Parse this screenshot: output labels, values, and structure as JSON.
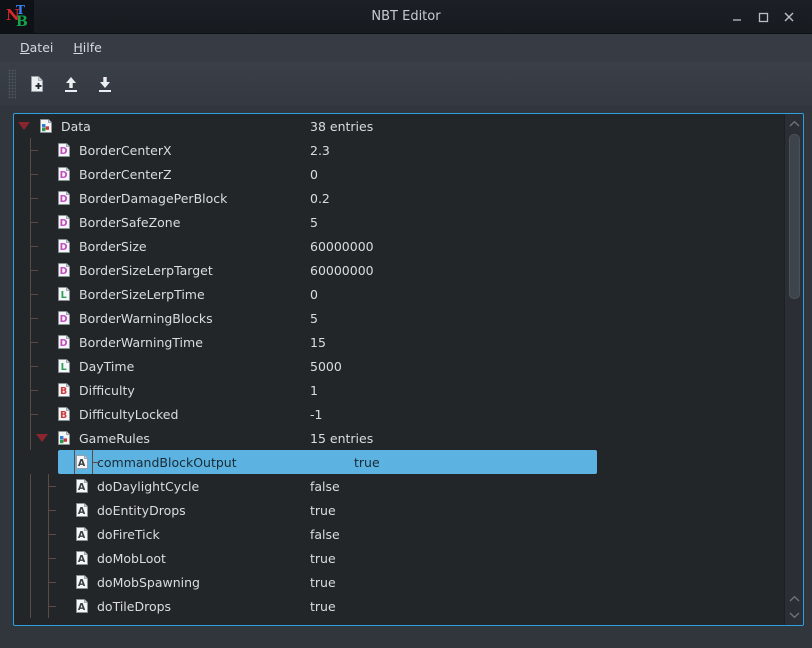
{
  "window": {
    "title": "NBT Editor",
    "logo": {
      "letters": [
        "N",
        "T",
        "B"
      ],
      "colors": [
        "#d62828",
        "#3b82f6",
        "#16a34a"
      ]
    },
    "buttons": [
      {
        "name": "minimize-button",
        "icon": "minimize-icon"
      },
      {
        "name": "maximize-button",
        "icon": "maximize-icon"
      },
      {
        "name": "close-button",
        "icon": "close-icon"
      }
    ]
  },
  "menubar": {
    "items": [
      {
        "label": "Datei",
        "mnemonic": "D",
        "rest": "atei"
      },
      {
        "label": "Hilfe",
        "mnemonic": "H",
        "rest": "ilfe"
      }
    ]
  },
  "toolbar": {
    "buttons": [
      {
        "name": "new-file-button",
        "icon": "new-file-icon"
      },
      {
        "name": "open-file-button",
        "icon": "arrow-up-icon"
      },
      {
        "name": "save-file-button",
        "icon": "arrow-down-icon"
      }
    ]
  },
  "colors": {
    "accent": "#2e9fe0",
    "selection": "#5cb3e2",
    "tree_background": "#232629",
    "chrome": "#31363d",
    "byte_tag": "#d03b3b",
    "double_tag": "#c24ec2",
    "long_tag": "#2f9e52",
    "string_tag": "#3a3f45"
  },
  "tree": {
    "rows": [
      {
        "name": "Data",
        "value": "38 entries",
        "icon": "compound-tag-icon",
        "depth": 0,
        "expanded": true,
        "selected": false
      },
      {
        "name": "BorderCenterX",
        "value": "2.3",
        "icon": "double-tag-icon",
        "depth": 1,
        "expanded": null,
        "selected": false
      },
      {
        "name": "BorderCenterZ",
        "value": "0",
        "icon": "double-tag-icon",
        "depth": 1,
        "expanded": null,
        "selected": false
      },
      {
        "name": "BorderDamagePerBlock",
        "value": "0.2",
        "icon": "double-tag-icon",
        "depth": 1,
        "expanded": null,
        "selected": false
      },
      {
        "name": "BorderSafeZone",
        "value": "5",
        "icon": "double-tag-icon",
        "depth": 1,
        "expanded": null,
        "selected": false
      },
      {
        "name": "BorderSize",
        "value": "60000000",
        "icon": "double-tag-icon",
        "depth": 1,
        "expanded": null,
        "selected": false
      },
      {
        "name": "BorderSizeLerpTarget",
        "value": "60000000",
        "icon": "double-tag-icon",
        "depth": 1,
        "expanded": null,
        "selected": false
      },
      {
        "name": "BorderSizeLerpTime",
        "value": "0",
        "icon": "long-tag-icon",
        "depth": 1,
        "expanded": null,
        "selected": false
      },
      {
        "name": "BorderWarningBlocks",
        "value": "5",
        "icon": "double-tag-icon",
        "depth": 1,
        "expanded": null,
        "selected": false
      },
      {
        "name": "BorderWarningTime",
        "value": "15",
        "icon": "double-tag-icon",
        "depth": 1,
        "expanded": null,
        "selected": false
      },
      {
        "name": "DayTime",
        "value": "5000",
        "icon": "long-tag-icon",
        "depth": 1,
        "expanded": null,
        "selected": false
      },
      {
        "name": "Difficulty",
        "value": "1",
        "icon": "byte-tag-icon",
        "depth": 1,
        "expanded": null,
        "selected": false
      },
      {
        "name": "DifficultyLocked",
        "value": "-1",
        "icon": "byte-tag-icon",
        "depth": 1,
        "expanded": null,
        "selected": false
      },
      {
        "name": "GameRules",
        "value": "15 entries",
        "icon": "compound-tag-icon",
        "depth": 1,
        "expanded": true,
        "selected": false
      },
      {
        "name": "commandBlockOutput",
        "value": "true",
        "icon": "string-tag-icon",
        "depth": 2,
        "expanded": null,
        "selected": true
      },
      {
        "name": "doDaylightCycle",
        "value": "false",
        "icon": "string-tag-icon",
        "depth": 2,
        "expanded": null,
        "selected": false
      },
      {
        "name": "doEntityDrops",
        "value": "true",
        "icon": "string-tag-icon",
        "depth": 2,
        "expanded": null,
        "selected": false
      },
      {
        "name": "doFireTick",
        "value": "false",
        "icon": "string-tag-icon",
        "depth": 2,
        "expanded": null,
        "selected": false
      },
      {
        "name": "doMobLoot",
        "value": "true",
        "icon": "string-tag-icon",
        "depth": 2,
        "expanded": null,
        "selected": false
      },
      {
        "name": "doMobSpawning",
        "value": "true",
        "icon": "string-tag-icon",
        "depth": 2,
        "expanded": null,
        "selected": false
      },
      {
        "name": "doTileDrops",
        "value": "true",
        "icon": "string-tag-icon",
        "depth": 2,
        "expanded": null,
        "selected": false
      }
    ]
  },
  "scrollbar": {
    "orientation": "vertical",
    "steppers": [
      "scroll-up-arrow",
      "scroll-up-arrow",
      "scroll-down-arrow"
    ]
  }
}
